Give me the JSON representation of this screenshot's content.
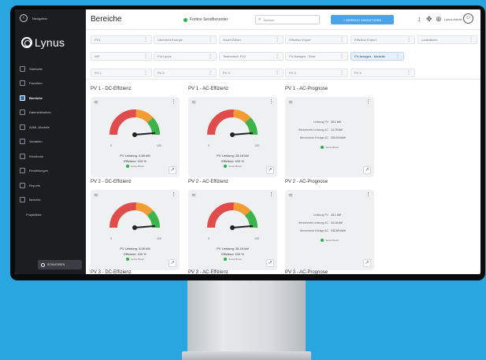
{
  "sidebar": {
    "back_label": "Navigation",
    "logo": "Lynus",
    "items": [
      {
        "label": "Startseite"
      },
      {
        "label": "Favoriten"
      },
      {
        "label": "Bereiche",
        "active": true
      },
      {
        "label": "Datenbibliothek"
      },
      {
        "label": "AI/ML-Modelle"
      },
      {
        "label": "Variablen"
      },
      {
        "label": "Workbook"
      },
      {
        "label": "Einstellungen"
      },
      {
        "label": "Reports"
      },
      {
        "label": "Berichte"
      },
      {
        "label": "Projektliste",
        "sub": true
      }
    ],
    "collapse_label": "SCHLIESSEN"
  },
  "header": {
    "title": "Bereiche",
    "server_status": "Fortino Sendforcenter",
    "search_placeholder": "Suchen",
    "add_button": "+ BEREICH HINZUFÜGEN",
    "user_label": "Lynus Admin",
    "accent": "#4aa3ea"
  },
  "filters": [
    "PV1",
    "Übersicht Energie",
    "Strom Zähler",
    "Effizienz Import",
    "Effizienz Export",
    "Ladesäulen",
    "WP",
    "Für Lynus",
    "Testbereich PV2",
    "PV-Anlagen - Start",
    "PV-Anlagen - Modelle",
    "PV 1",
    "PV 2",
    "PV 3",
    "PV 4",
    "PV 5"
  ],
  "sections": [
    {
      "title": "PV 1 - DC-Effizienz",
      "type": "gauge",
      "line1": "PV Leistung: 4.88 kW",
      "line2": "Effizienz: 100 %",
      "status": "Server Bereit",
      "value": 100
    },
    {
      "title": "PV 1 - AC-Effizienz",
      "type": "gauge",
      "line1": "PV Leistung: 28.18 kW",
      "line2": "Effizienz: 100 %",
      "status": "Server Bereit",
      "value": 100
    },
    {
      "title": "PV 1 - AC-Prognose",
      "type": "forecast",
      "rows": [
        [
          "Leistung PV",
          "28.1 kW"
        ],
        [
          "Berechnete Leistung AC",
          "14.75 kW"
        ],
        [
          "Berechnete Erträge AC",
          "200.03 kWh"
        ]
      ],
      "status": "Server Bereit"
    },
    {
      "title": "PV 2 - DC-Effizienz",
      "type": "gauge",
      "line1": "PV Leistung: 3.08 kW",
      "line2": "Effizienz: 100 %",
      "status": "Server Bereit",
      "value": 100
    },
    {
      "title": "PV 2 - AC-Effizienz",
      "type": "gauge",
      "line1": "PV Leistung: 28.18 kW",
      "line2": "Effizienz: 100 %",
      "status": "Server Bereit",
      "value": 100
    },
    {
      "title": "PV 2 - AC-Prognose",
      "type": "forecast",
      "rows": [
        [
          "Leistung PV",
          "28.1 kW"
        ],
        [
          "Berechnete Leistung AC",
          "16.18 kW"
        ],
        [
          "Berechnete Erträge AC",
          "432.80 kWh"
        ]
      ],
      "status": "Server Bereit"
    }
  ],
  "gauge": {
    "min": "0",
    "max": "100",
    "mid1": "100",
    "mid2": "250",
    "colors": {
      "red": "#e14b4b",
      "orange": "#f39c34",
      "green": "#3cb44b"
    }
  },
  "cut_titles": [
    "PV 3 - DC-Effizienz",
    "PV 3 - AC-Effizienz",
    "PV 3 - AC-Prognose"
  ]
}
